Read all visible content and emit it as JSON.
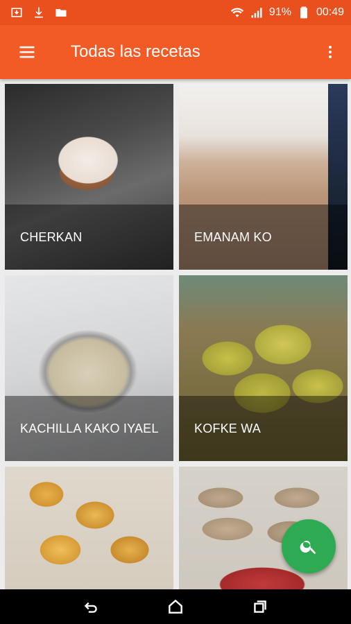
{
  "status_bar": {
    "battery": "91%",
    "time": "00:49",
    "icons": [
      "image-download-icon",
      "download-icon",
      "folder-icon",
      "wifi-icon",
      "signal-icon",
      "battery-icon"
    ]
  },
  "app_bar": {
    "title": "Todas las recetas",
    "menu_icon": "hamburger-menu-icon",
    "more_icon": "more-vert-icon"
  },
  "recipes": [
    {
      "name": "CHERKAN"
    },
    {
      "name": "EMANAM KO"
    },
    {
      "name": "KACHILLA KAKO IYAEL"
    },
    {
      "name": "KOFKE WA"
    },
    {
      "name": ""
    },
    {
      "name": ""
    }
  ],
  "fab": {
    "icon": "search-icon",
    "color": "#2eaa52"
  },
  "nav_bar": {
    "icons": [
      "back-icon",
      "home-icon",
      "recents-icon"
    ]
  },
  "colors": {
    "primary": "#f35b26",
    "primary_dark": "#e9501d",
    "accent": "#2eaa52"
  }
}
